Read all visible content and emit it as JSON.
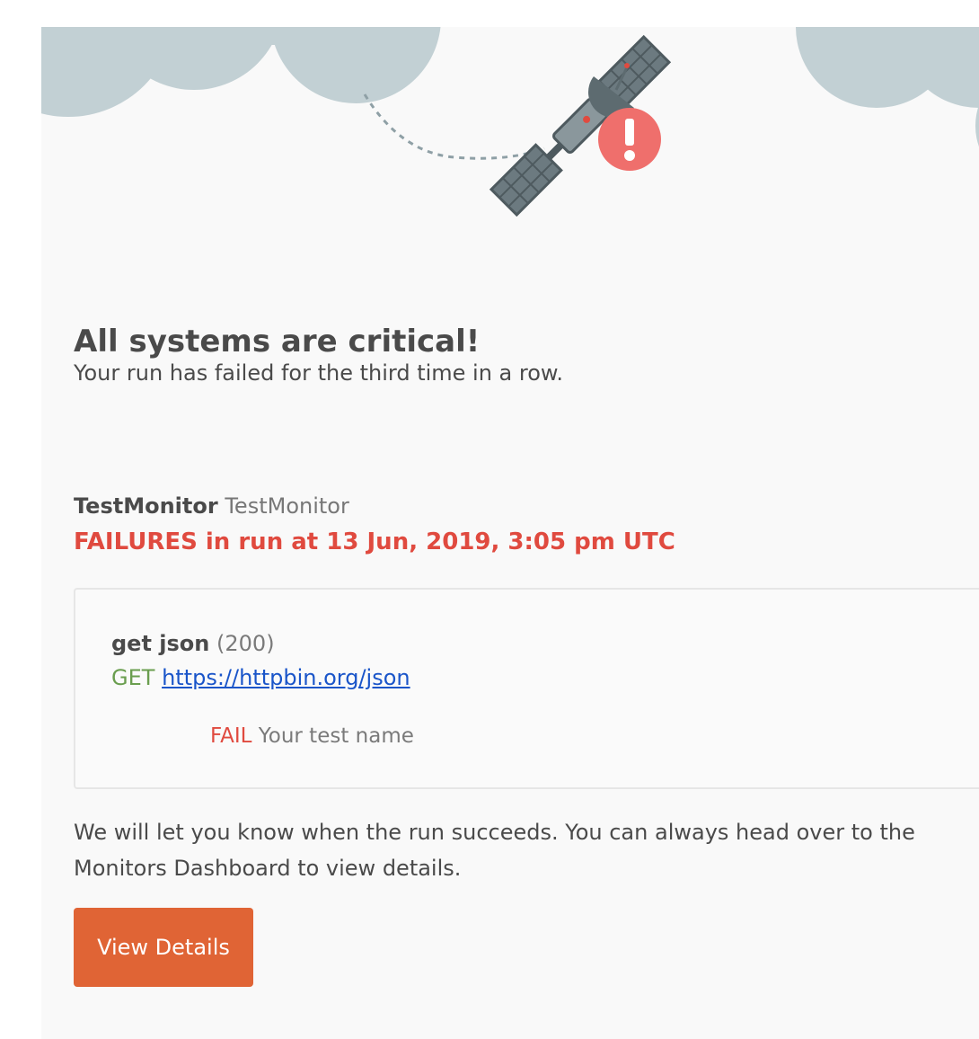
{
  "colors": {
    "page_background": "#f9f9f9",
    "cloud": "#c2d0d4",
    "alert_red": "#e04a3f",
    "method_green": "#6a9e4f",
    "link_blue": "#1a55c9",
    "button_orange": "#e06435"
  },
  "hero": {
    "illustration": "satellite-alert-icon"
  },
  "alert": {
    "headline": "All systems are critical!",
    "subline": "Your run has failed for the third time in a row."
  },
  "monitor": {
    "name": "TestMonitor",
    "collection": "TestMonitor",
    "failures_heading": "FAILURES in run at 13 Jun, 2019, 3:05 pm UTC"
  },
  "request": {
    "name": "get json",
    "status": "(200)",
    "method": "GET",
    "url": "https://httpbin.org/json",
    "assertion_status": "FAIL",
    "assertion_name": "Your test name"
  },
  "footer": {
    "line1": "We will let you know when the run succeeds. You can always head over to the",
    "line2": "Monitors Dashboard to view details."
  },
  "button": {
    "label": "View Details"
  }
}
